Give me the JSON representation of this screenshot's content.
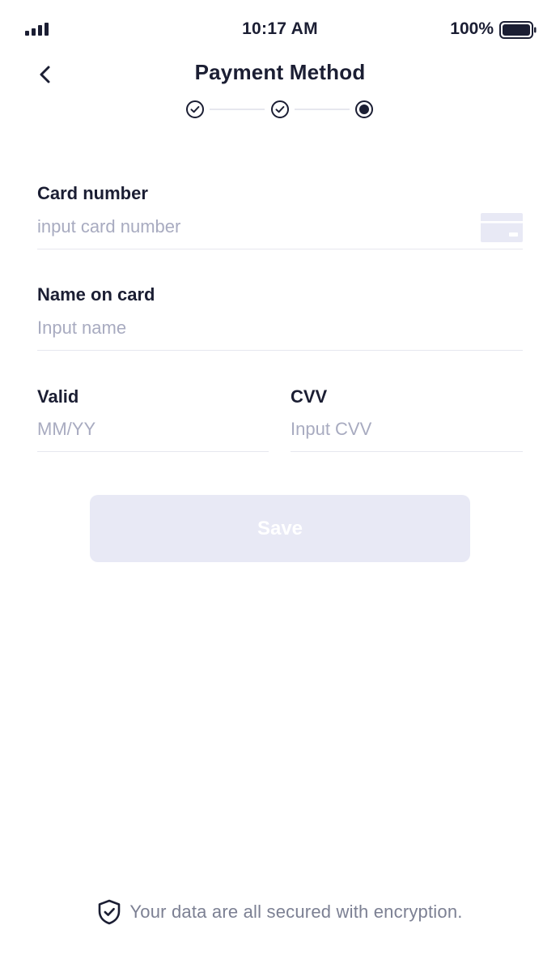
{
  "status_bar": {
    "time": "10:17 AM",
    "battery_percent": "100%",
    "battery_level": 1.0,
    "signal_icon": "signal-bars-icon",
    "battery_icon": "battery-icon"
  },
  "header": {
    "title": "Payment Method",
    "back_icon": "chevron-left-icon"
  },
  "stepper": {
    "steps": [
      {
        "state": "completed"
      },
      {
        "state": "completed"
      },
      {
        "state": "current"
      }
    ]
  },
  "form": {
    "card_number": {
      "label": "Card number",
      "placeholder": "input card number",
      "value": "",
      "icon": "credit-card-icon"
    },
    "name_on_card": {
      "label": "Name on card",
      "placeholder": "Input name",
      "value": ""
    },
    "valid": {
      "label": "Valid",
      "placeholder": "MM/YY",
      "value": ""
    },
    "cvv": {
      "label": "CVV",
      "placeholder": "Input CVV",
      "value": ""
    },
    "save_label": "Save"
  },
  "footer": {
    "security_text": "Your data are all secured with encryption.",
    "security_icon": "shield-check-icon"
  },
  "colors": {
    "text_primary": "#1b1e33",
    "placeholder": "#a8abc0",
    "divider": "#e6e7ef",
    "button_disabled_bg": "#e8e9f5",
    "footer_text": "#7c8093"
  }
}
